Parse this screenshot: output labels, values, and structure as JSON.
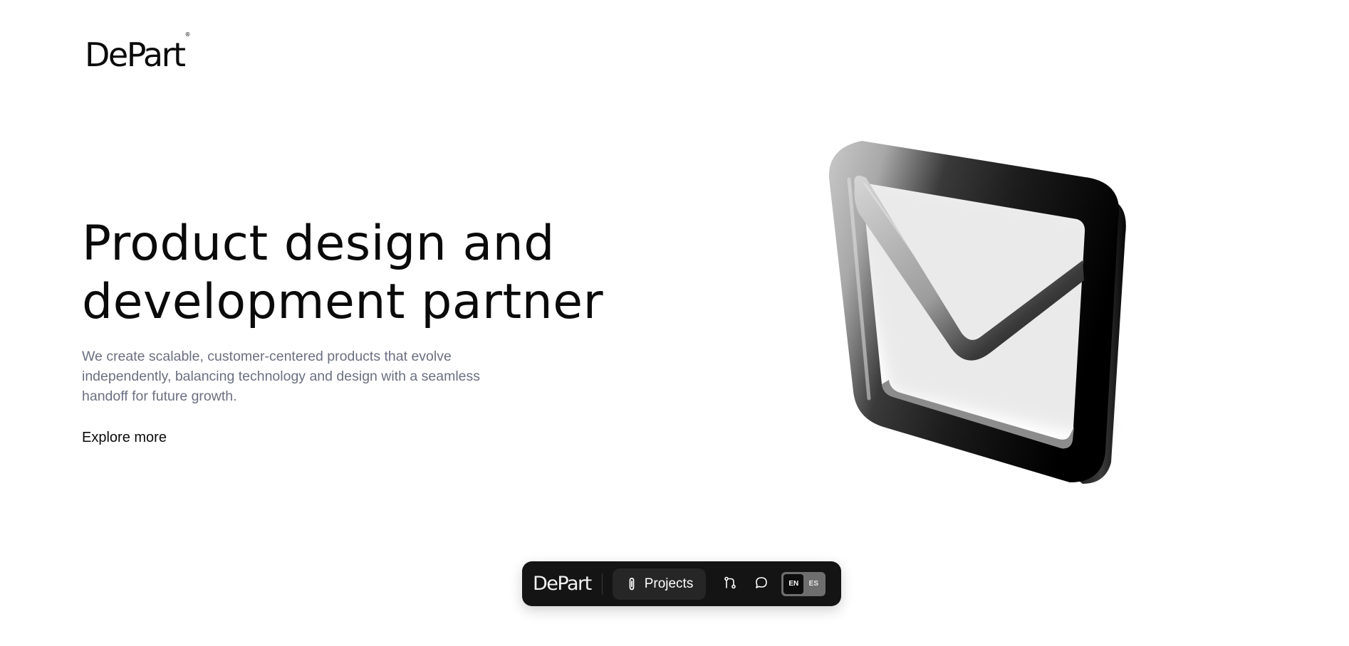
{
  "brand": {
    "name": "DePart",
    "registered_mark": "®"
  },
  "hero": {
    "headline_line1": "Product design and",
    "headline_line2": "development partner",
    "description": "We create scalable, customer-centered products that evolve independently, balancing technology and design with a seamless handoff for future growth.",
    "cta_label": "Explore more",
    "art_icon": "envelope-3d-icon"
  },
  "dock": {
    "logo": "DePart",
    "projects_label": "Projects",
    "projects_icon": "paperclip-icon",
    "process_icon": "git-merge-icon",
    "contact_icon": "chat-bubble-icon",
    "languages": [
      "EN",
      "ES"
    ],
    "active_language": "EN"
  },
  "colors": {
    "text": "#0a0a0a",
    "muted": "#6b7080",
    "dock_bg": "#141414",
    "dock_pill": "#262626"
  }
}
